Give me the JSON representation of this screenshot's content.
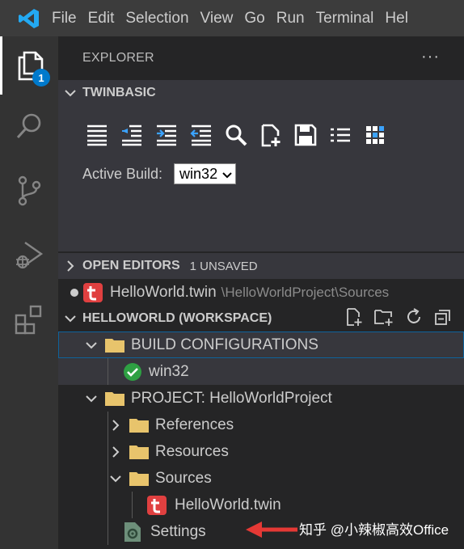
{
  "menu": [
    "File",
    "Edit",
    "Selection",
    "View",
    "Go",
    "Run",
    "Terminal",
    "Hel"
  ],
  "activity": {
    "explorer_badge": "1"
  },
  "explorer": {
    "title": "EXPLORER",
    "more": "···"
  },
  "twinbasic": {
    "header": "TWINBASIC",
    "active_build_label": "Active Build:",
    "active_build_value": "win32",
    "toolbar_icons": [
      "outdent-all-icon",
      "outdent-icon",
      "indent-icon",
      "unindent-icon",
      "search-icon",
      "new-file-icon",
      "save-icon",
      "list-icon",
      "grid-icon"
    ]
  },
  "open_editors": {
    "header": "OPEN EDITORS",
    "unsaved": "1 UNSAVED",
    "items": [
      {
        "name": "HelloWorld.twin",
        "path": "\\HelloWorldProject\\Sources"
      }
    ]
  },
  "workspace": {
    "header": "HELLOWORLD (WORKSPACE)",
    "tree": {
      "build_configurations": "BUILD CONFIGURATIONS",
      "win32": "win32",
      "project": "PROJECT: HelloWorldProject",
      "references": "References",
      "resources": "Resources",
      "sources": "Sources",
      "helloworld_twin": "HelloWorld.twin",
      "settings": "Settings"
    }
  },
  "colors": {
    "accent": "#007acc",
    "folder": "#e8c46c",
    "twin_red": "#e04040",
    "check_green": "#2ea043"
  },
  "watermark": "知乎 @小辣椒高效Office"
}
